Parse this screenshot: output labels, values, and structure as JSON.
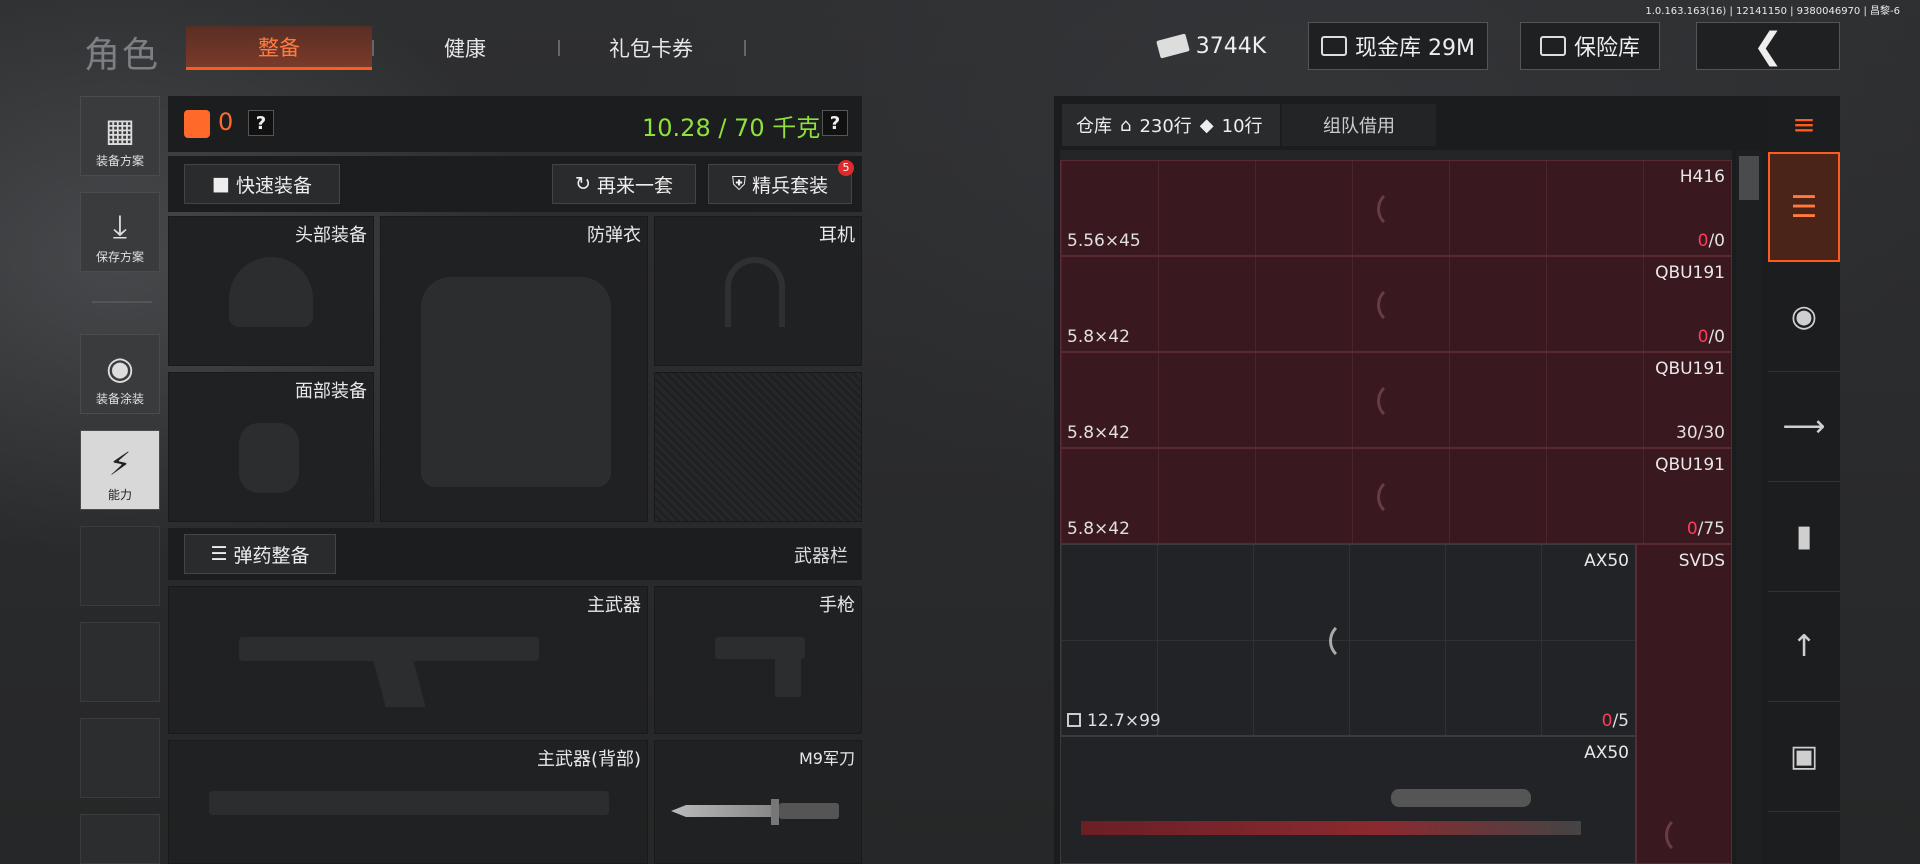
{
  "version": "1.0.163.163(16) | 12141150 | 9380046970 | 昌黎-6",
  "header": {
    "title": "角色",
    "tabs": [
      "整备",
      "健康",
      "礼包卡券"
    ],
    "currency": "3744K",
    "cash_vault": "现金库 29M",
    "safe": "保险库"
  },
  "leftnav": [
    "装备方案",
    "保存方案",
    "装备涂装",
    "能力"
  ],
  "equip": {
    "armor_count": "0",
    "weight": "10.28 / 70 千克",
    "quick_equip": "快速装备",
    "again": "再来一套",
    "elite": "精兵套装",
    "elite_badge": "5",
    "slots": {
      "head": "头部装备",
      "vest": "防弹衣",
      "headset": "耳机",
      "face": "面部装备"
    },
    "ammo_btn": "弹药整备",
    "weapon_bar": "武器栏",
    "main_weapon": "主武器",
    "pistol": "手枪",
    "main_weapon_back": "主武器(背部)",
    "knife": "M9军刀"
  },
  "warehouse": {
    "tab_label": "仓库",
    "rows": "230行",
    "rows2": "10行",
    "team": "组队借用",
    "items": [
      {
        "name": "H416",
        "caliber": "5.56×45",
        "count_a": "0",
        "count_b": "/0"
      },
      {
        "name": "QBU191",
        "caliber": "5.8×42",
        "count_a": "0",
        "count_b": "/0"
      },
      {
        "name": "QBU191",
        "caliber": "5.8×42",
        "count_a": "30/30",
        "count_b": ""
      },
      {
        "name": "QBU191",
        "caliber": "5.8×42",
        "count_a": "0",
        "count_b": "/75"
      }
    ],
    "ax50a": {
      "name": "AX50",
      "caliber": "12.7×99",
      "count_a": "0",
      "count_b": "/5"
    },
    "svds": "SVDS",
    "ax50b": "AX50"
  },
  "colors": {
    "accent": "#ff5a1f",
    "weight_green": "#8ee03a",
    "warn_red": "#ff3c5a"
  },
  "icons": [
    "sort-icon",
    "stack-icon",
    "helmet-icon",
    "rifle-icon",
    "magazine-icon",
    "bullet-icon",
    "scope-icon"
  ]
}
